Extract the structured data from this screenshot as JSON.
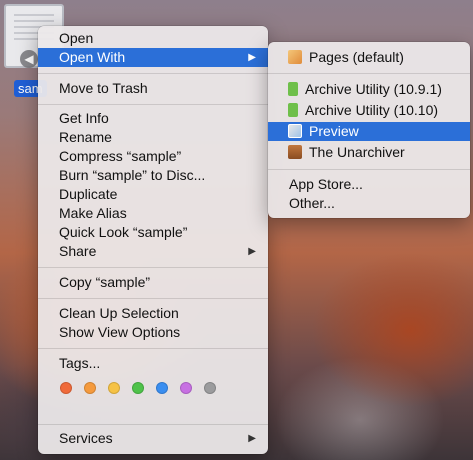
{
  "desktop": {
    "icon_label": "sam"
  },
  "context_menu": {
    "open": "Open",
    "open_with": "Open With",
    "move_to_trash": "Move to Trash",
    "get_info": "Get Info",
    "rename": "Rename",
    "compress": "Compress “sample”",
    "burn": "Burn “sample” to Disc...",
    "duplicate": "Duplicate",
    "make_alias": "Make Alias",
    "quick_look": "Quick Look “sample”",
    "share": "Share",
    "copy": "Copy “sample”",
    "clean_up": "Clean Up Selection",
    "show_view_options": "Show View Options",
    "tags": "Tags...",
    "tag_colors": [
      "#f06a3a",
      "#f59a3d",
      "#f6c245",
      "#4fc24a",
      "#3a8ef0",
      "#c770e2",
      "#9b9b9d"
    ],
    "services": "Services",
    "submenu_arrow": "▶"
  },
  "open_with_menu": {
    "pages": "Pages (default)",
    "archive_1091": "Archive Utility (10.9.1)",
    "archive_1010": "Archive Utility (10.10)",
    "preview": "Preview",
    "unarchiver": "The Unarchiver",
    "app_store": "App Store...",
    "other": "Other..."
  }
}
